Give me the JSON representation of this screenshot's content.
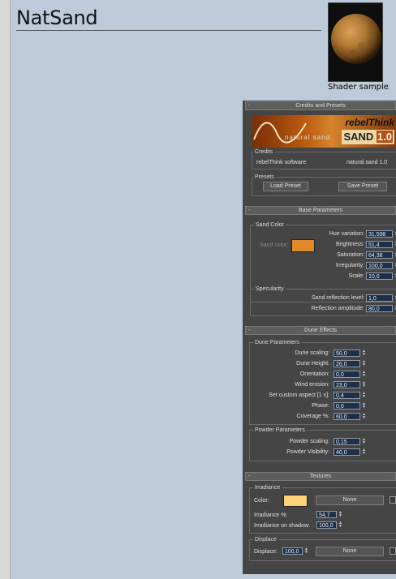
{
  "page": {
    "title": "NatSand",
    "sample_caption": "Shader sample"
  },
  "credits_panel": {
    "header": "Credits and Presets",
    "collapse": "-",
    "logo_brand": "rebelThink",
    "logo_product": "SAND",
    "logo_version": "1.0",
    "logo_subtitle": "natural sand",
    "credits_label": "Credits",
    "credits_left": "rebelThink software",
    "credits_right": "natural.sand 1.0",
    "presets_label": "Presets",
    "load_preset": "Load Preset",
    "save_preset": "Save Preset"
  },
  "base_panel": {
    "header": "Base Parameters",
    "collapse": "-",
    "sand_color_label": "Sand Color",
    "sand_color_field": "Sand color:",
    "sand_color_hex": "#e08a2c",
    "hue_label": "Hue variation:",
    "hue_value": "31,598",
    "brightness_label": "Brightness:",
    "brightness_value": "51,4",
    "saturation_label": "Saturation:",
    "saturation_value": "64,38",
    "irregularity_label": "Irregularity:",
    "irregularity_value": "100,0",
    "scale_label": "Scale:",
    "scale_value": "10,0",
    "specularity_label": "Specularity",
    "reflection_level_label": "Sand reflection level:",
    "reflection_level_value": "1,0",
    "reflection_amp_label": "Reflection amplitude:",
    "reflection_amp_value": "80,0"
  },
  "dune_panel": {
    "header": "Dune Effects",
    "collapse": "-",
    "dune_params_label": "Dune Parameters",
    "dune_scaling_label": "Dune scaling:",
    "dune_scaling_value": "50,0",
    "dune_height_label": "Dune Height:",
    "dune_height_value": "26,0",
    "orientation_label": "Orientation:",
    "orientation_value": "0,0",
    "wind_erosion_label": "Wind erosion:",
    "wind_erosion_value": "23,0",
    "custom_aspect_label": "Set custom aspect [1 x]:",
    "custom_aspect_value": "0,4",
    "phase_label": "Phase:",
    "phase_value": "0,0",
    "coverage_label": "Coverage %:",
    "coverage_value": "60,0",
    "powder_params_label": "Powder Parameters",
    "powder_scaling_label": "Powder scaling:",
    "powder_scaling_value": "0,15",
    "powder_visibility_label": "Powder Visibility:",
    "powder_visibility_value": "40,0"
  },
  "textures_panel": {
    "header": "Textures",
    "collapse": "-",
    "irradiance_label": "Irradiance",
    "color_label": "Color:",
    "irradiance_color_hex": "#fbd277",
    "color_map": "None",
    "irradiance_pct_label": "Irradiance %:",
    "irradiance_pct_value": "54,7",
    "irradiance_shadow_label": "Irradiance on shadow:",
    "irradiance_shadow_value": "100,0",
    "displace_label": "Displace",
    "displace_field_label": "Displace:",
    "displace_value": "100,0",
    "displace_map": "None"
  },
  "icons": {
    "spinner": "spinner-arrows-icon",
    "collapse": "minus-icon"
  }
}
